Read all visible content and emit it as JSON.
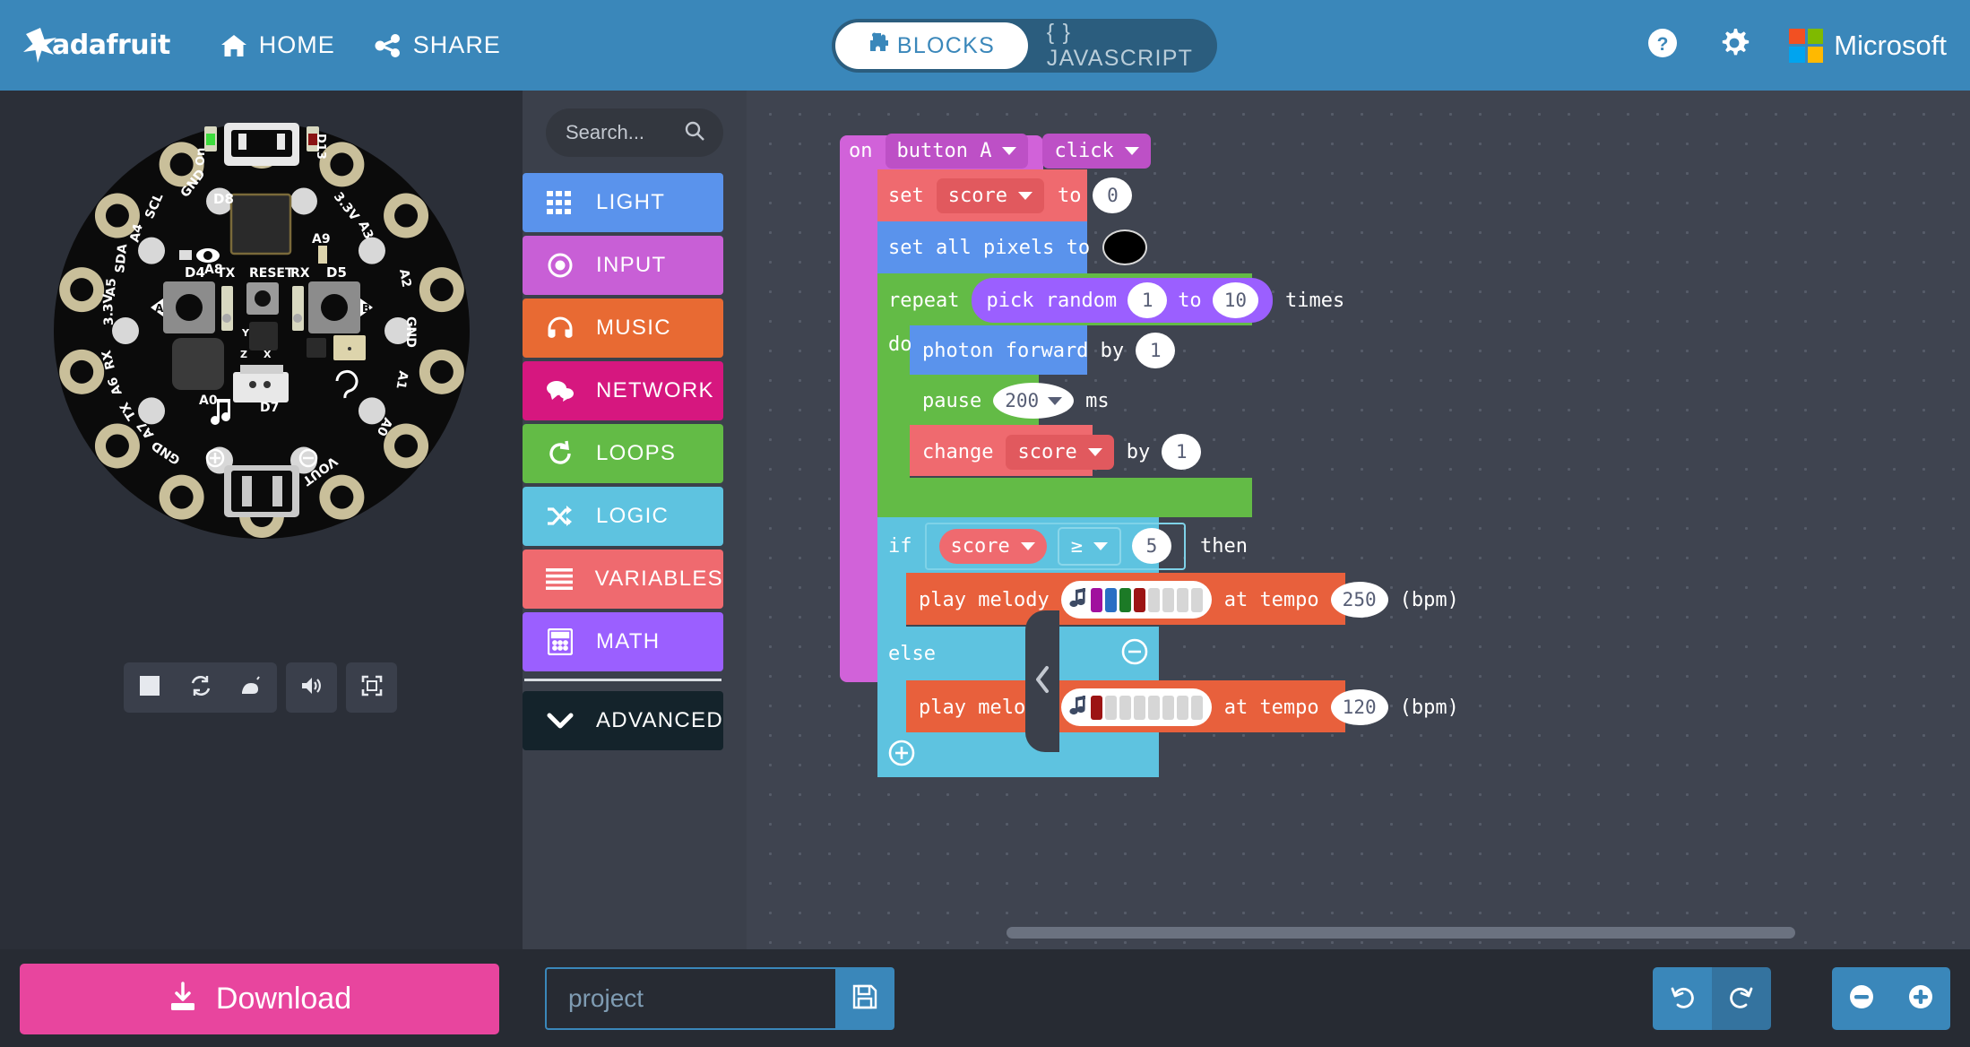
{
  "header": {
    "brand": "adafruit",
    "brand_icon": "adafruit-star-icon",
    "home_label": "HOME",
    "home_icon": "home-icon",
    "share_label": "SHARE",
    "share_icon": "share-icon",
    "blocks_label": "BLOCKS",
    "blocks_icon": "puzzle-icon",
    "javascript_label": "{ } JAVASCRIPT",
    "help_icon": "help-circle-icon",
    "settings_icon": "gear-icon",
    "microsoft_label": "Microsoft",
    "microsoft_icon": "microsoft-logo-icon",
    "bg_color": "#3a87ba",
    "toggle_bg_color": "#2b5d7e"
  },
  "simulator": {
    "board_name": "circuit-playground-express",
    "board_labels": [
      "On",
      "D13",
      "GND",
      "D8",
      "3.3V",
      "SCL",
      "A4",
      "A3",
      "SDA",
      "A5",
      "A2",
      "3.3V",
      "A8",
      "A9",
      "D4",
      "TX",
      "RESET",
      "RX",
      "D5",
      "GND",
      "A",
      "B",
      "Y",
      "Z",
      "X",
      "RX",
      "A6",
      "A1",
      "TX",
      "A7",
      "A0",
      "D7",
      "GND",
      "VOUT",
      "A0"
    ],
    "controls": [
      {
        "name": "stop-button",
        "icon": "stop-icon"
      },
      {
        "name": "restart-button",
        "icon": "restart-icon"
      },
      {
        "name": "slow-motion-button",
        "icon": "snail-icon"
      },
      {
        "name": "mute-button",
        "icon": "speaker-icon"
      },
      {
        "name": "fullscreen-button",
        "icon": "fullscreen-icon"
      }
    ]
  },
  "toolbox": {
    "search_placeholder": "Search...",
    "search_icon": "search-icon",
    "collapse_icon": "chevron-left-icon",
    "categories": [
      {
        "label": "LIGHT",
        "icon": "grid-icon",
        "color": "#5a93ec"
      },
      {
        "label": "INPUT",
        "icon": "eye-target-icon",
        "color": "#c85fd6"
      },
      {
        "label": "MUSIC",
        "icon": "headphones-icon",
        "color": "#e86a33"
      },
      {
        "label": "NETWORK",
        "icon": "comments-icon",
        "color": "#d6177f"
      },
      {
        "label": "LOOPS",
        "icon": "refresh-icon",
        "color": "#63bb46"
      },
      {
        "label": "LOGIC",
        "icon": "shuffle-icon",
        "color": "#5ec3e0"
      },
      {
        "label": "VARIABLES",
        "icon": "list-lines-icon",
        "color": "#ef6a6f"
      },
      {
        "label": "MATH",
        "icon": "calculator-icon",
        "color": "#9b5fff"
      }
    ],
    "advanced": {
      "label": "ADVANCED",
      "icon": "chevron-down-icon",
      "color": "#14232b"
    }
  },
  "workspace": {
    "blocks": {
      "on_event": {
        "keyword": "on",
        "source": "button A",
        "event": "click",
        "color": "#d162d9"
      },
      "set_var": {
        "keyword": "set",
        "variable": "score",
        "to_label": "to",
        "value": "0",
        "color": "#ef6a6f"
      },
      "set_pixels": {
        "label": "set all pixels to",
        "color_value": "#000000",
        "color": "#5a93ec"
      },
      "repeat": {
        "keyword": "repeat",
        "times_label": "times",
        "do_label": "do",
        "color": "#63bb46",
        "pick_random": {
          "label": "pick random",
          "from": "1",
          "to_label": "to",
          "to": "10",
          "color": "#9b5fff"
        }
      },
      "photon_forward": {
        "label": "photon forward by",
        "value": "1",
        "color": "#5a93ec"
      },
      "pause": {
        "keyword": "pause",
        "value": "200",
        "unit": "ms",
        "color": "#63bb46"
      },
      "change_var": {
        "keyword": "change",
        "variable": "score",
        "by_label": "by",
        "value": "1",
        "color": "#ef6a6f"
      },
      "if_else": {
        "if_label": "if",
        "then_label": "then",
        "else_label": "else",
        "color": "#5ec3e0",
        "minus_icon": "minus-circle-icon",
        "plus_icon": "plus-circle-icon",
        "condition": {
          "left_variable": "score",
          "left_color": "#ef6a6f",
          "operator": "≥",
          "right_value": "5"
        }
      },
      "play_melody_1": {
        "label": "play melody",
        "tempo_label": "at tempo",
        "tempo": "250",
        "bpm_label": "(bpm)",
        "note_icon": "music-note-icon",
        "color": "#e8603c",
        "bars": [
          "#a1109e",
          "#2a6fc4",
          "#1c7a26",
          "#9c1414",
          "#d6d6d6",
          "#d6d6d6",
          "#d6d6d6",
          "#d6d6d6"
        ]
      },
      "play_melody_2": {
        "label": "play melody",
        "tempo_label": "at tempo",
        "tempo": "120",
        "bpm_label": "(bpm)",
        "note_icon": "music-note-icon",
        "color": "#e8603c",
        "bars": [
          "#9c1414",
          "#d6d6d6",
          "#d6d6d6",
          "#d6d6d6",
          "#d6d6d6",
          "#d6d6d6",
          "#d6d6d6",
          "#d6d6d6"
        ]
      }
    }
  },
  "footer": {
    "download_label": "Download",
    "download_icon": "download-icon",
    "download_color": "#e8459e",
    "project_placeholder": "project",
    "save_icon": "floppy-save-icon",
    "undo_icon": "undo-icon",
    "redo_icon": "redo-icon",
    "zoom_out_icon": "zoom-out-icon",
    "zoom_in_icon": "zoom-in-icon"
  }
}
